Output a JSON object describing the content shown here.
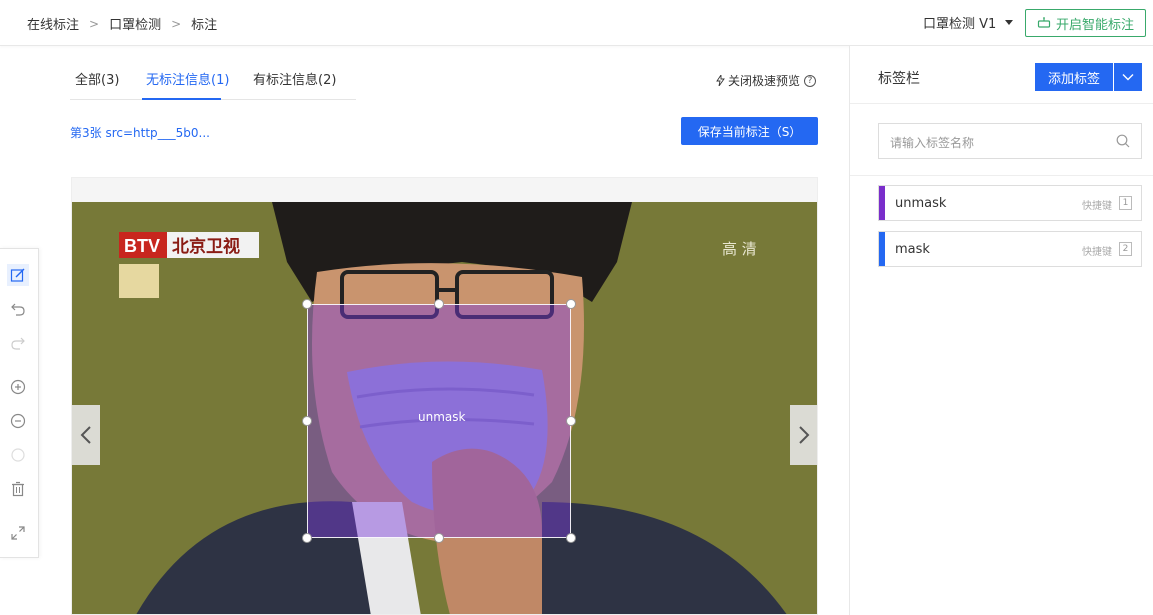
{
  "breadcrumb": {
    "items": [
      "在线标注",
      "口罩检测",
      "标注"
    ],
    "separator": ">"
  },
  "header": {
    "model_select": "口罩检测  V1",
    "smart_button": "开启智能标注"
  },
  "tabs": [
    {
      "label": "全部(3)",
      "active": false
    },
    {
      "label": "无标注信息(1)",
      "active": true
    },
    {
      "label": "有标注信息(2)",
      "active": false
    }
  ],
  "preview_toggle": "关闭极速预览",
  "image_title": "第3张 src=http___5b0...",
  "save_button": "保存当前标注（S）",
  "annotation": {
    "label": "unmask",
    "color": "#7c3cdc"
  },
  "photo": {
    "channel_logo": "BTV",
    "channel_name": "北京卫视",
    "hd_mark": "高 清"
  },
  "toolbar": {
    "tools": [
      "edit-box-icon",
      "undo-icon",
      "redo-icon",
      "zoom-in-icon",
      "zoom-out-icon",
      "reset-icon",
      "delete-icon",
      "fullscreen-icon"
    ]
  },
  "label_panel": {
    "title": "标签栏",
    "add_button": "添加标签",
    "search_placeholder": "请输入标签名称",
    "labels": [
      {
        "name": "unmask",
        "shortcut_text": "快捷键",
        "key": "1",
        "color": "#7a2ecb"
      },
      {
        "name": "mask",
        "shortcut_text": "快捷键",
        "key": "2",
        "color": "#2468f2"
      }
    ]
  },
  "colors": {
    "primary": "#2468f2",
    "green": "#39a96b"
  }
}
